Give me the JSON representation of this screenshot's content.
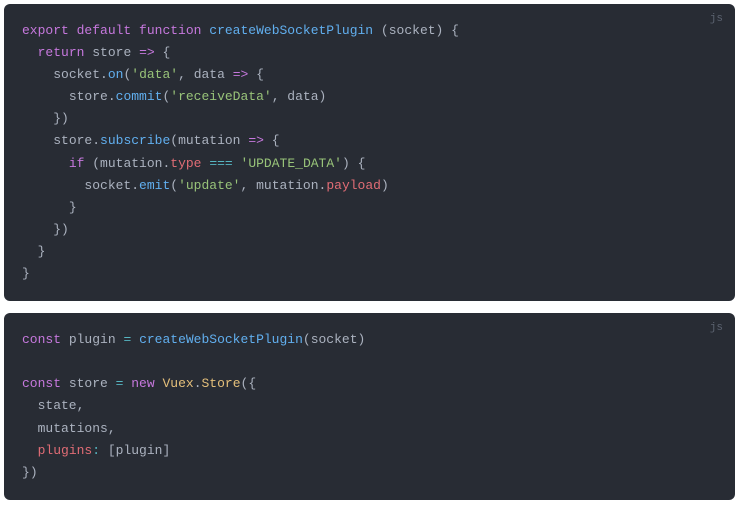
{
  "blocks": [
    {
      "lang": "js",
      "lines": [
        [
          {
            "t": "export",
            "c": "kw-export"
          },
          {
            "t": " ",
            "c": "plain"
          },
          {
            "t": "default",
            "c": "kw-export"
          },
          {
            "t": " ",
            "c": "plain"
          },
          {
            "t": "function",
            "c": "kw-export"
          },
          {
            "t": " ",
            "c": "plain"
          },
          {
            "t": "createWebSocketPlugin",
            "c": "fn-name"
          },
          {
            "t": " ",
            "c": "plain"
          },
          {
            "t": "(",
            "c": "punct"
          },
          {
            "t": "socket",
            "c": "param"
          },
          {
            "t": ")",
            "c": "punct"
          },
          {
            "t": " ",
            "c": "plain"
          },
          {
            "t": "{",
            "c": "punct"
          }
        ],
        [
          {
            "t": "  ",
            "c": "plain"
          },
          {
            "t": "return",
            "c": "kw-return"
          },
          {
            "t": " ",
            "c": "plain"
          },
          {
            "t": "store",
            "c": "param"
          },
          {
            "t": " ",
            "c": "plain"
          },
          {
            "t": "=>",
            "c": "kw-arrow"
          },
          {
            "t": " ",
            "c": "plain"
          },
          {
            "t": "{",
            "c": "punct"
          }
        ],
        [
          {
            "t": "    ",
            "c": "plain"
          },
          {
            "t": "socket",
            "c": "plain"
          },
          {
            "t": ".",
            "c": "punct"
          },
          {
            "t": "on",
            "c": "fn-call"
          },
          {
            "t": "(",
            "c": "punct"
          },
          {
            "t": "'data'",
            "c": "str"
          },
          {
            "t": ",",
            "c": "punct"
          },
          {
            "t": " ",
            "c": "plain"
          },
          {
            "t": "data",
            "c": "param"
          },
          {
            "t": " ",
            "c": "plain"
          },
          {
            "t": "=>",
            "c": "kw-arrow"
          },
          {
            "t": " ",
            "c": "plain"
          },
          {
            "t": "{",
            "c": "punct"
          }
        ],
        [
          {
            "t": "      ",
            "c": "plain"
          },
          {
            "t": "store",
            "c": "plain"
          },
          {
            "t": ".",
            "c": "punct"
          },
          {
            "t": "commit",
            "c": "fn-call"
          },
          {
            "t": "(",
            "c": "punct"
          },
          {
            "t": "'receiveData'",
            "c": "str"
          },
          {
            "t": ",",
            "c": "punct"
          },
          {
            "t": " data",
            "c": "plain"
          },
          {
            "t": ")",
            "c": "punct"
          }
        ],
        [
          {
            "t": "    ",
            "c": "plain"
          },
          {
            "t": "}",
            "c": "punct"
          },
          {
            "t": ")",
            "c": "punct"
          }
        ],
        [
          {
            "t": "    ",
            "c": "plain"
          },
          {
            "t": "store",
            "c": "plain"
          },
          {
            "t": ".",
            "c": "punct"
          },
          {
            "t": "subscribe",
            "c": "fn-call"
          },
          {
            "t": "(",
            "c": "punct"
          },
          {
            "t": "mutation",
            "c": "param"
          },
          {
            "t": " ",
            "c": "plain"
          },
          {
            "t": "=>",
            "c": "kw-arrow"
          },
          {
            "t": " ",
            "c": "plain"
          },
          {
            "t": "{",
            "c": "punct"
          }
        ],
        [
          {
            "t": "      ",
            "c": "plain"
          },
          {
            "t": "if",
            "c": "kw-if"
          },
          {
            "t": " ",
            "c": "plain"
          },
          {
            "t": "(",
            "c": "punct"
          },
          {
            "t": "mutation",
            "c": "plain"
          },
          {
            "t": ".",
            "c": "punct"
          },
          {
            "t": "type",
            "c": "prop"
          },
          {
            "t": " ",
            "c": "plain"
          },
          {
            "t": "===",
            "c": "op"
          },
          {
            "t": " ",
            "c": "plain"
          },
          {
            "t": "'UPDATE_DATA'",
            "c": "str"
          },
          {
            "t": ")",
            "c": "punct"
          },
          {
            "t": " ",
            "c": "plain"
          },
          {
            "t": "{",
            "c": "punct"
          }
        ],
        [
          {
            "t": "        ",
            "c": "plain"
          },
          {
            "t": "socket",
            "c": "plain"
          },
          {
            "t": ".",
            "c": "punct"
          },
          {
            "t": "emit",
            "c": "fn-call"
          },
          {
            "t": "(",
            "c": "punct"
          },
          {
            "t": "'update'",
            "c": "str"
          },
          {
            "t": ",",
            "c": "punct"
          },
          {
            "t": " mutation",
            "c": "plain"
          },
          {
            "t": ".",
            "c": "punct"
          },
          {
            "t": "payload",
            "c": "prop"
          },
          {
            "t": ")",
            "c": "punct"
          }
        ],
        [
          {
            "t": "      ",
            "c": "plain"
          },
          {
            "t": "}",
            "c": "punct"
          }
        ],
        [
          {
            "t": "    ",
            "c": "plain"
          },
          {
            "t": "}",
            "c": "punct"
          },
          {
            "t": ")",
            "c": "punct"
          }
        ],
        [
          {
            "t": "  ",
            "c": "plain"
          },
          {
            "t": "}",
            "c": "punct"
          }
        ],
        [
          {
            "t": "}",
            "c": "punct"
          }
        ]
      ]
    },
    {
      "lang": "js",
      "lines": [
        [
          {
            "t": "const",
            "c": "kw-const"
          },
          {
            "t": " plugin ",
            "c": "plain"
          },
          {
            "t": "=",
            "c": "op"
          },
          {
            "t": " ",
            "c": "plain"
          },
          {
            "t": "createWebSocketPlugin",
            "c": "fn-call"
          },
          {
            "t": "(",
            "c": "punct"
          },
          {
            "t": "socket",
            "c": "plain"
          },
          {
            "t": ")",
            "c": "punct"
          }
        ],
        [
          {
            "t": " ",
            "c": "plain"
          }
        ],
        [
          {
            "t": "const",
            "c": "kw-const"
          },
          {
            "t": " store ",
            "c": "plain"
          },
          {
            "t": "=",
            "c": "op"
          },
          {
            "t": " ",
            "c": "plain"
          },
          {
            "t": "new",
            "c": "kw-new"
          },
          {
            "t": " ",
            "c": "plain"
          },
          {
            "t": "Vuex",
            "c": "class-name"
          },
          {
            "t": ".",
            "c": "punct"
          },
          {
            "t": "Store",
            "c": "class-name"
          },
          {
            "t": "(",
            "c": "punct"
          },
          {
            "t": "{",
            "c": "punct"
          }
        ],
        [
          {
            "t": "  state",
            "c": "plain"
          },
          {
            "t": ",",
            "c": "punct"
          }
        ],
        [
          {
            "t": "  mutations",
            "c": "plain"
          },
          {
            "t": ",",
            "c": "punct"
          }
        ],
        [
          {
            "t": "  ",
            "c": "plain"
          },
          {
            "t": "plugins",
            "c": "var"
          },
          {
            "t": ":",
            "c": "op"
          },
          {
            "t": " ",
            "c": "plain"
          },
          {
            "t": "[",
            "c": "punct"
          },
          {
            "t": "plugin",
            "c": "plain"
          },
          {
            "t": "]",
            "c": "punct"
          }
        ],
        [
          {
            "t": "}",
            "c": "punct"
          },
          {
            "t": ")",
            "c": "punct"
          }
        ]
      ]
    }
  ]
}
